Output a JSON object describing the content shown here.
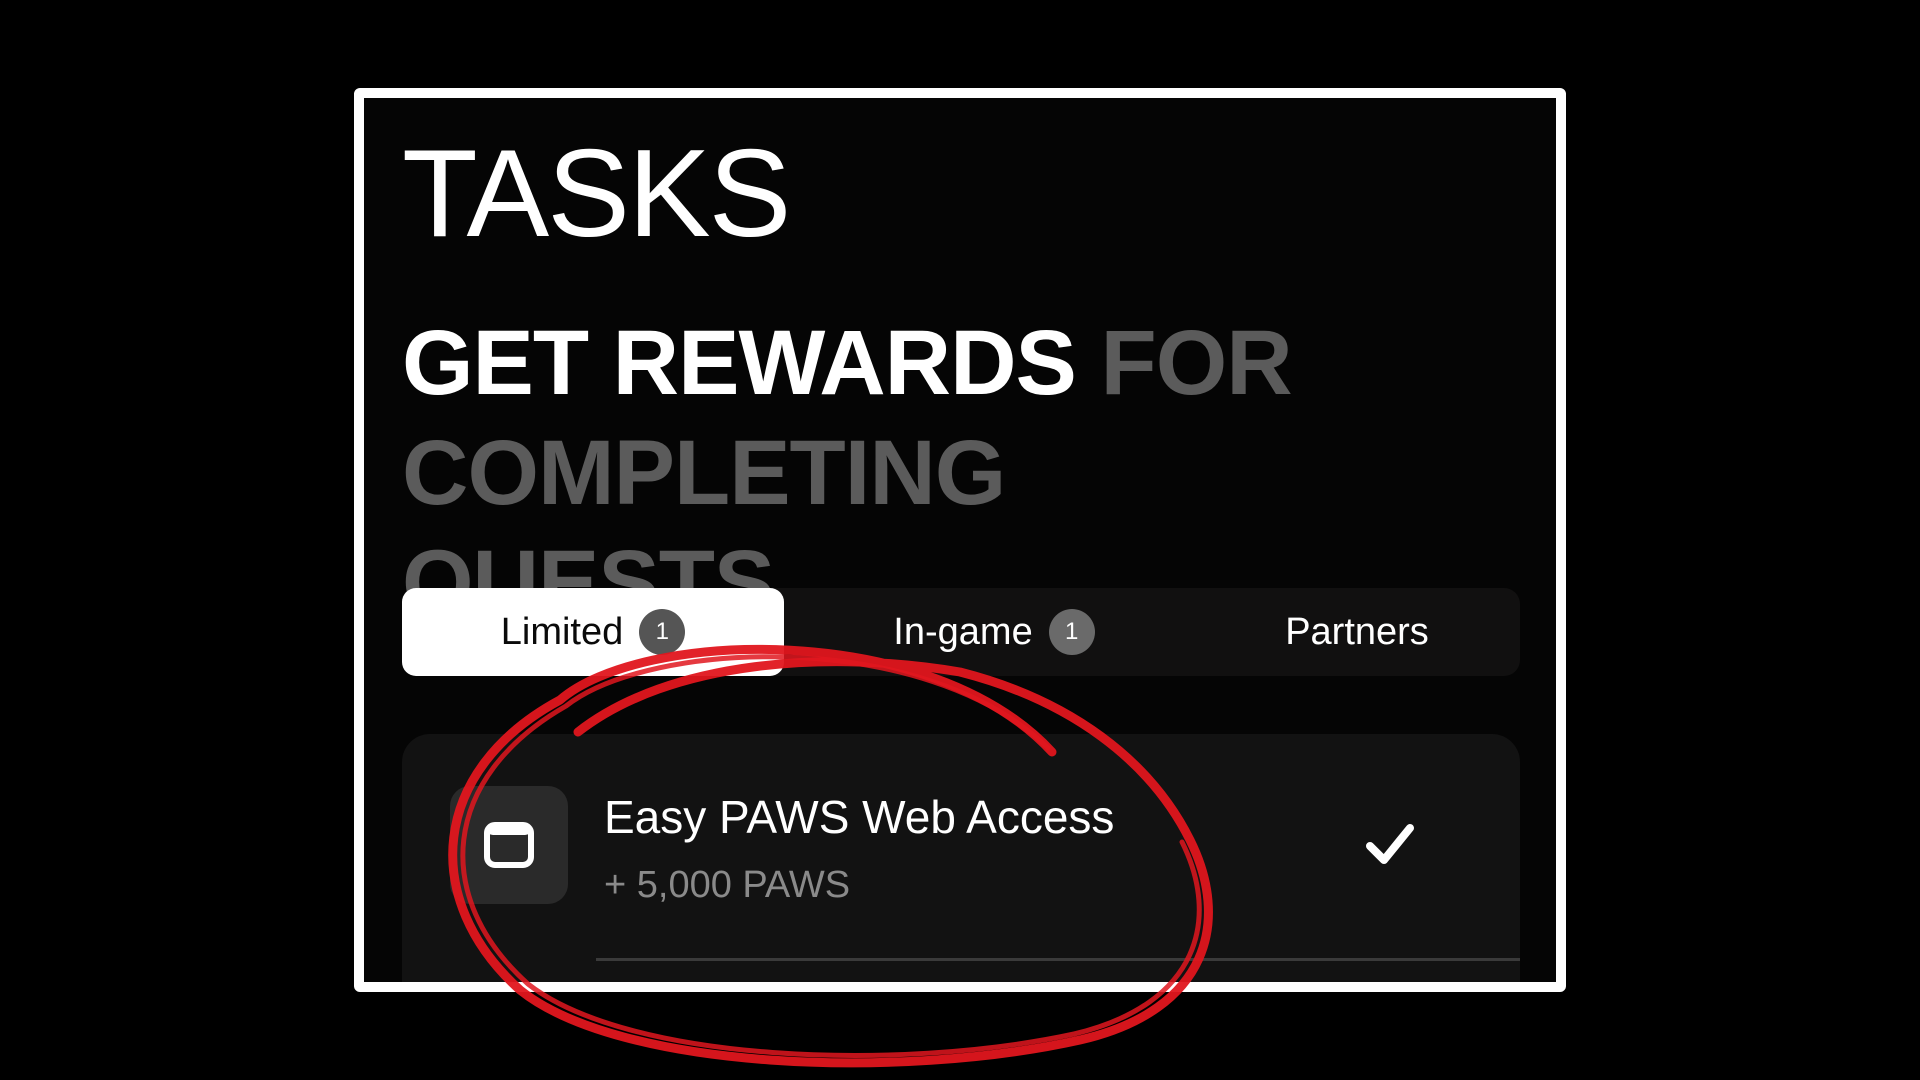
{
  "header": {
    "title": "TASKS",
    "subtitle_bright": "GET REWARDS",
    "subtitle_dim": "FOR COMPLETING QUESTS"
  },
  "tabs": [
    {
      "label": "Limited",
      "count": "1",
      "active": true
    },
    {
      "label": "In-game",
      "count": "1",
      "active": false
    },
    {
      "label": "Partners",
      "active": false
    }
  ],
  "task": {
    "title": "Easy PAWS Web Access",
    "reward": "+ 5,000 PAWS",
    "completed": true,
    "icon": "browser-window-icon",
    "status_icon": "checkmark-icon"
  },
  "annotation": {
    "color": "#e0161e",
    "shape": "hand-drawn-circle"
  },
  "colors": {
    "background": "#000000",
    "frame_border": "#ffffff",
    "dim_text": "#5b5b5b",
    "active_tab": "#ffffff"
  }
}
